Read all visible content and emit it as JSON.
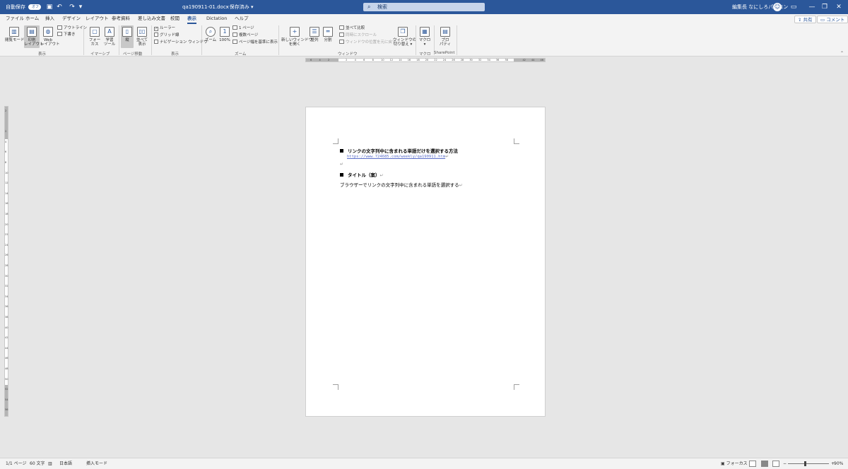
{
  "titlebar": {
    "autosave_label": "自動保存",
    "autosave_state": "オフ",
    "qat_save_icon": "save-icon",
    "qat_undo_icon": "undo-icon",
    "qat_redo_icon": "redo-icon",
    "qat_more": "▾",
    "filename": "qa190911-01.docx",
    "save_status": "保存済み",
    "search_placeholder": "検索",
    "user_name": "編集長 なにしろパソコン",
    "colors": {
      "titlebar": "#2b579a",
      "accent": "#2b579a"
    }
  },
  "tabs": [
    "ファイル",
    "ホーム",
    "挿入",
    "デザイン",
    "レイアウト",
    "参考資料",
    "差し込み文書",
    "校閲",
    "表示",
    "Dictation",
    "ヘルプ"
  ],
  "active_tab": "表示",
  "share_label": "共有",
  "comment_label": "コメント",
  "ribbon": {
    "view": {
      "group": "表示",
      "read_mode": "閲覧モード",
      "print_layout_1": "印刷",
      "print_layout_2": "レイアウト",
      "web_layout_1": "Web",
      "web_layout_2": "レイアウト",
      "outline": "アウトライン",
      "draft": "下書き"
    },
    "immersive": {
      "group": "イマーシブ",
      "focus_1": "フォー",
      "focus_2": "カス",
      "learning_1": "学習",
      "learning_2": "ツール"
    },
    "page_move": {
      "group": "ページ移動",
      "vertical": "縦",
      "side_1": "並べて",
      "side_2": "表示"
    },
    "show": {
      "group": "表示",
      "ruler": "ルーラー",
      "gridlines": "グリッド線",
      "nav_pane": "ナビゲーション ウィンドウ",
      "ruler_checked": "✓"
    },
    "zoom": {
      "group": "ズーム",
      "zoom": "ズーム",
      "hundred": "100%",
      "one_page": "1 ページ",
      "multiple_pages": "複数ページ",
      "page_width": "ページ幅を基準に表示"
    },
    "window": {
      "group": "ウィンドウ",
      "new_window_1": "新しいウィンドウ",
      "new_window_2": "を開く",
      "arrange": "整列",
      "split": "分割",
      "side_by_side": "並べて比較",
      "sync_scroll": "同時にスクロール",
      "reset_position": "ウィンドウの位置を元に戻す",
      "switch_1": "ウィンドウの",
      "switch_2": "切り替え"
    },
    "macro": {
      "group": "マクロ",
      "macro": "マクロ"
    },
    "sharepoint": {
      "group": "SharePoint",
      "properties_1": "プロ",
      "properties_2": "パティ"
    }
  },
  "document": {
    "heading1": "リンクの文字列中に含まれる単語だけを選択する方法",
    "url": "https://www.724685.com/weekly/qa190911.htm",
    "heading2": "タイトル（案）",
    "body": "ブラウザーでリンクの文字列中に含まれる単語を選択する",
    "para_mark": "↵"
  },
  "statusbar": {
    "page": "1/1 ページ",
    "words": "60 文字",
    "language": "日本語",
    "mode": "挿入モード",
    "focus": "フォーカス",
    "zoom_minus": "−",
    "zoom_plus": "+",
    "zoom": "90%",
    "zoom_fraction": 0.9
  },
  "rulers": {
    "horizontal_ticks": [
      "6",
      "4",
      "2",
      "",
      "2",
      "4",
      "6",
      "8",
      "10",
      "12",
      "14",
      "16",
      "18",
      "20",
      "22",
      "24",
      "26",
      "28",
      "30",
      "32",
      "34",
      "36",
      "38",
      "",
      "42",
      "44",
      "46"
    ],
    "vertical_ticks": [
      "2",
      "",
      "2",
      "4",
      "6",
      "8",
      "10",
      "12",
      "14",
      "16",
      "18",
      "20",
      "22",
      "24",
      "26",
      "28",
      "30",
      "32",
      "34",
      "36",
      "38",
      "40",
      "42",
      "44",
      "46",
      "48",
      "50",
      "52",
      "54",
      "56"
    ]
  }
}
